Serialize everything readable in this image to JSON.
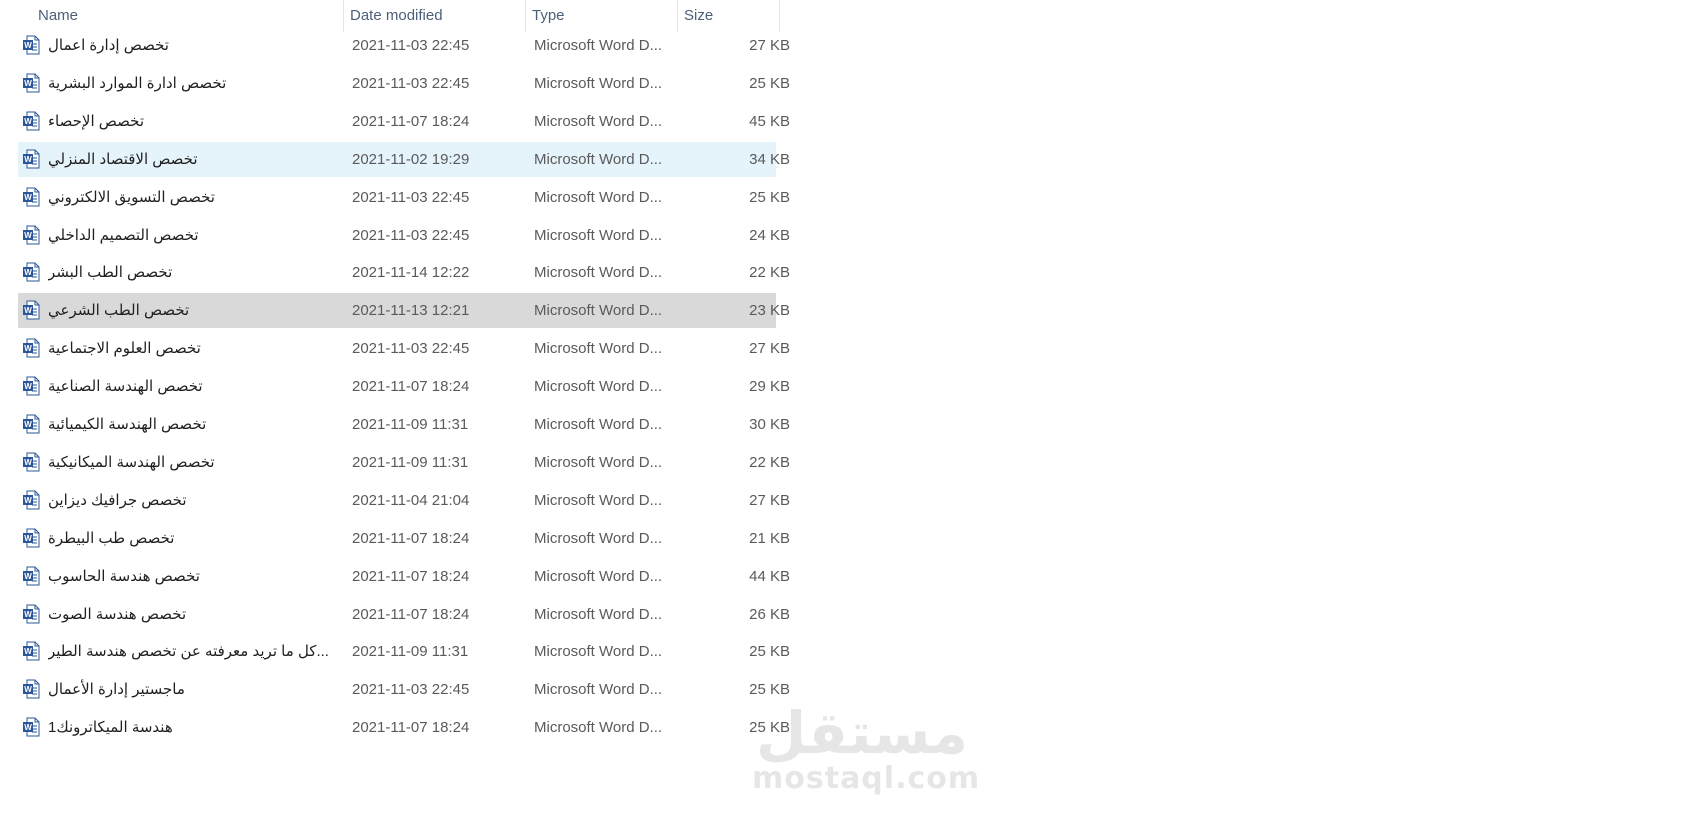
{
  "columns": {
    "name": "Name",
    "date": "Date modified",
    "type": "Type",
    "size": "Size"
  },
  "sort": {
    "column": "name",
    "indicator": "up-chevron-icon"
  },
  "colors": {
    "hover_row": "#e5f3fb",
    "selected_row": "#d9d9d9",
    "header_text": "#4c607a",
    "word_blue": "#2b579a"
  },
  "files": [
    {
      "name": "تخصص إدارة اعمال",
      "date": "2021-11-03 22:45",
      "type": "Microsoft Word D...",
      "size": "27 KB",
      "icon": "word-doc-icon",
      "state": "normal"
    },
    {
      "name": "تخصص ادارة الموارد البشرية",
      "date": "2021-11-03 22:45",
      "type": "Microsoft Word D...",
      "size": "25 KB",
      "icon": "word-doc-icon",
      "state": "normal"
    },
    {
      "name": "تخصص الإحصاء",
      "date": "2021-11-07 18:24",
      "type": "Microsoft Word D...",
      "size": "45 KB",
      "icon": "word-doc-icon",
      "state": "normal"
    },
    {
      "name": "تخصص الاقتصاد المنزلي",
      "date": "2021-11-02 19:29",
      "type": "Microsoft Word D...",
      "size": "34 KB",
      "icon": "word-doc-icon",
      "state": "hover"
    },
    {
      "name": "تخصص التسويق الالكتروني",
      "date": "2021-11-03 22:45",
      "type": "Microsoft Word D...",
      "size": "25 KB",
      "icon": "word-doc-icon",
      "state": "normal"
    },
    {
      "name": "تخصص التصميم الداخلي",
      "date": "2021-11-03 22:45",
      "type": "Microsoft Word D...",
      "size": "24 KB",
      "icon": "word-doc-icon",
      "state": "normal"
    },
    {
      "name": "تخصص الطب البشر",
      "date": "2021-11-14 12:22",
      "type": "Microsoft Word D...",
      "size": "22 KB",
      "icon": "word-doc-icon",
      "state": "normal"
    },
    {
      "name": "تخصص الطب الشرعي",
      "date": "2021-11-13 12:21",
      "type": "Microsoft Word D...",
      "size": "23 KB",
      "icon": "word-doc-icon",
      "state": "selected"
    },
    {
      "name": "تخصص العلوم الاجتماعية",
      "date": "2021-11-03 22:45",
      "type": "Microsoft Word D...",
      "size": "27 KB",
      "icon": "word-doc-icon",
      "state": "normal"
    },
    {
      "name": "تخصص الهندسة الصناعية",
      "date": "2021-11-07 18:24",
      "type": "Microsoft Word D...",
      "size": "29 KB",
      "icon": "word-doc-icon",
      "state": "normal"
    },
    {
      "name": "تخصص الهندسة الكيميائية",
      "date": "2021-11-09 11:31",
      "type": "Microsoft Word D...",
      "size": "30 KB",
      "icon": "word-doc-icon",
      "state": "normal"
    },
    {
      "name": "تخصص الهندسة الميكانيكية",
      "date": "2021-11-09 11:31",
      "type": "Microsoft Word D...",
      "size": "22 KB",
      "icon": "word-doc-icon",
      "state": "normal"
    },
    {
      "name": "تخصص جرافيك ديزاين",
      "date": "2021-11-04 21:04",
      "type": "Microsoft Word D...",
      "size": "27 KB",
      "icon": "word-doc-icon",
      "state": "normal"
    },
    {
      "name": "تخصص طب البيطرة",
      "date": "2021-11-07 18:24",
      "type": "Microsoft Word D...",
      "size": "21 KB",
      "icon": "word-doc-icon",
      "state": "normal"
    },
    {
      "name": "تخصص هندسة الحاسوب",
      "date": "2021-11-07 18:24",
      "type": "Microsoft Word D...",
      "size": "44 KB",
      "icon": "word-doc-icon",
      "state": "normal"
    },
    {
      "name": "تخصص هندسة الصوت",
      "date": "2021-11-07 18:24",
      "type": "Microsoft Word D...",
      "size": "26 KB",
      "icon": "word-doc-icon",
      "state": "normal"
    },
    {
      "name": "كل ما تريد معرفته عن تخصص هندسة الطير...",
      "date": "2021-11-09 11:31",
      "type": "Microsoft Word D...",
      "size": "25 KB",
      "icon": "word-doc-icon",
      "state": "normal"
    },
    {
      "name": "ماجستير إدارة الأعمال",
      "date": "2021-11-03 22:45",
      "type": "Microsoft Word D...",
      "size": "25 KB",
      "icon": "word-doc-icon",
      "state": "normal"
    },
    {
      "name": "هندسة الميكاترونك1",
      "date": "2021-11-07 18:24",
      "type": "Microsoft Word D...",
      "size": "25 KB",
      "icon": "word-doc-icon",
      "state": "normal"
    }
  ],
  "watermark": {
    "logo": "مستقل",
    "text": "mostaql.com"
  }
}
